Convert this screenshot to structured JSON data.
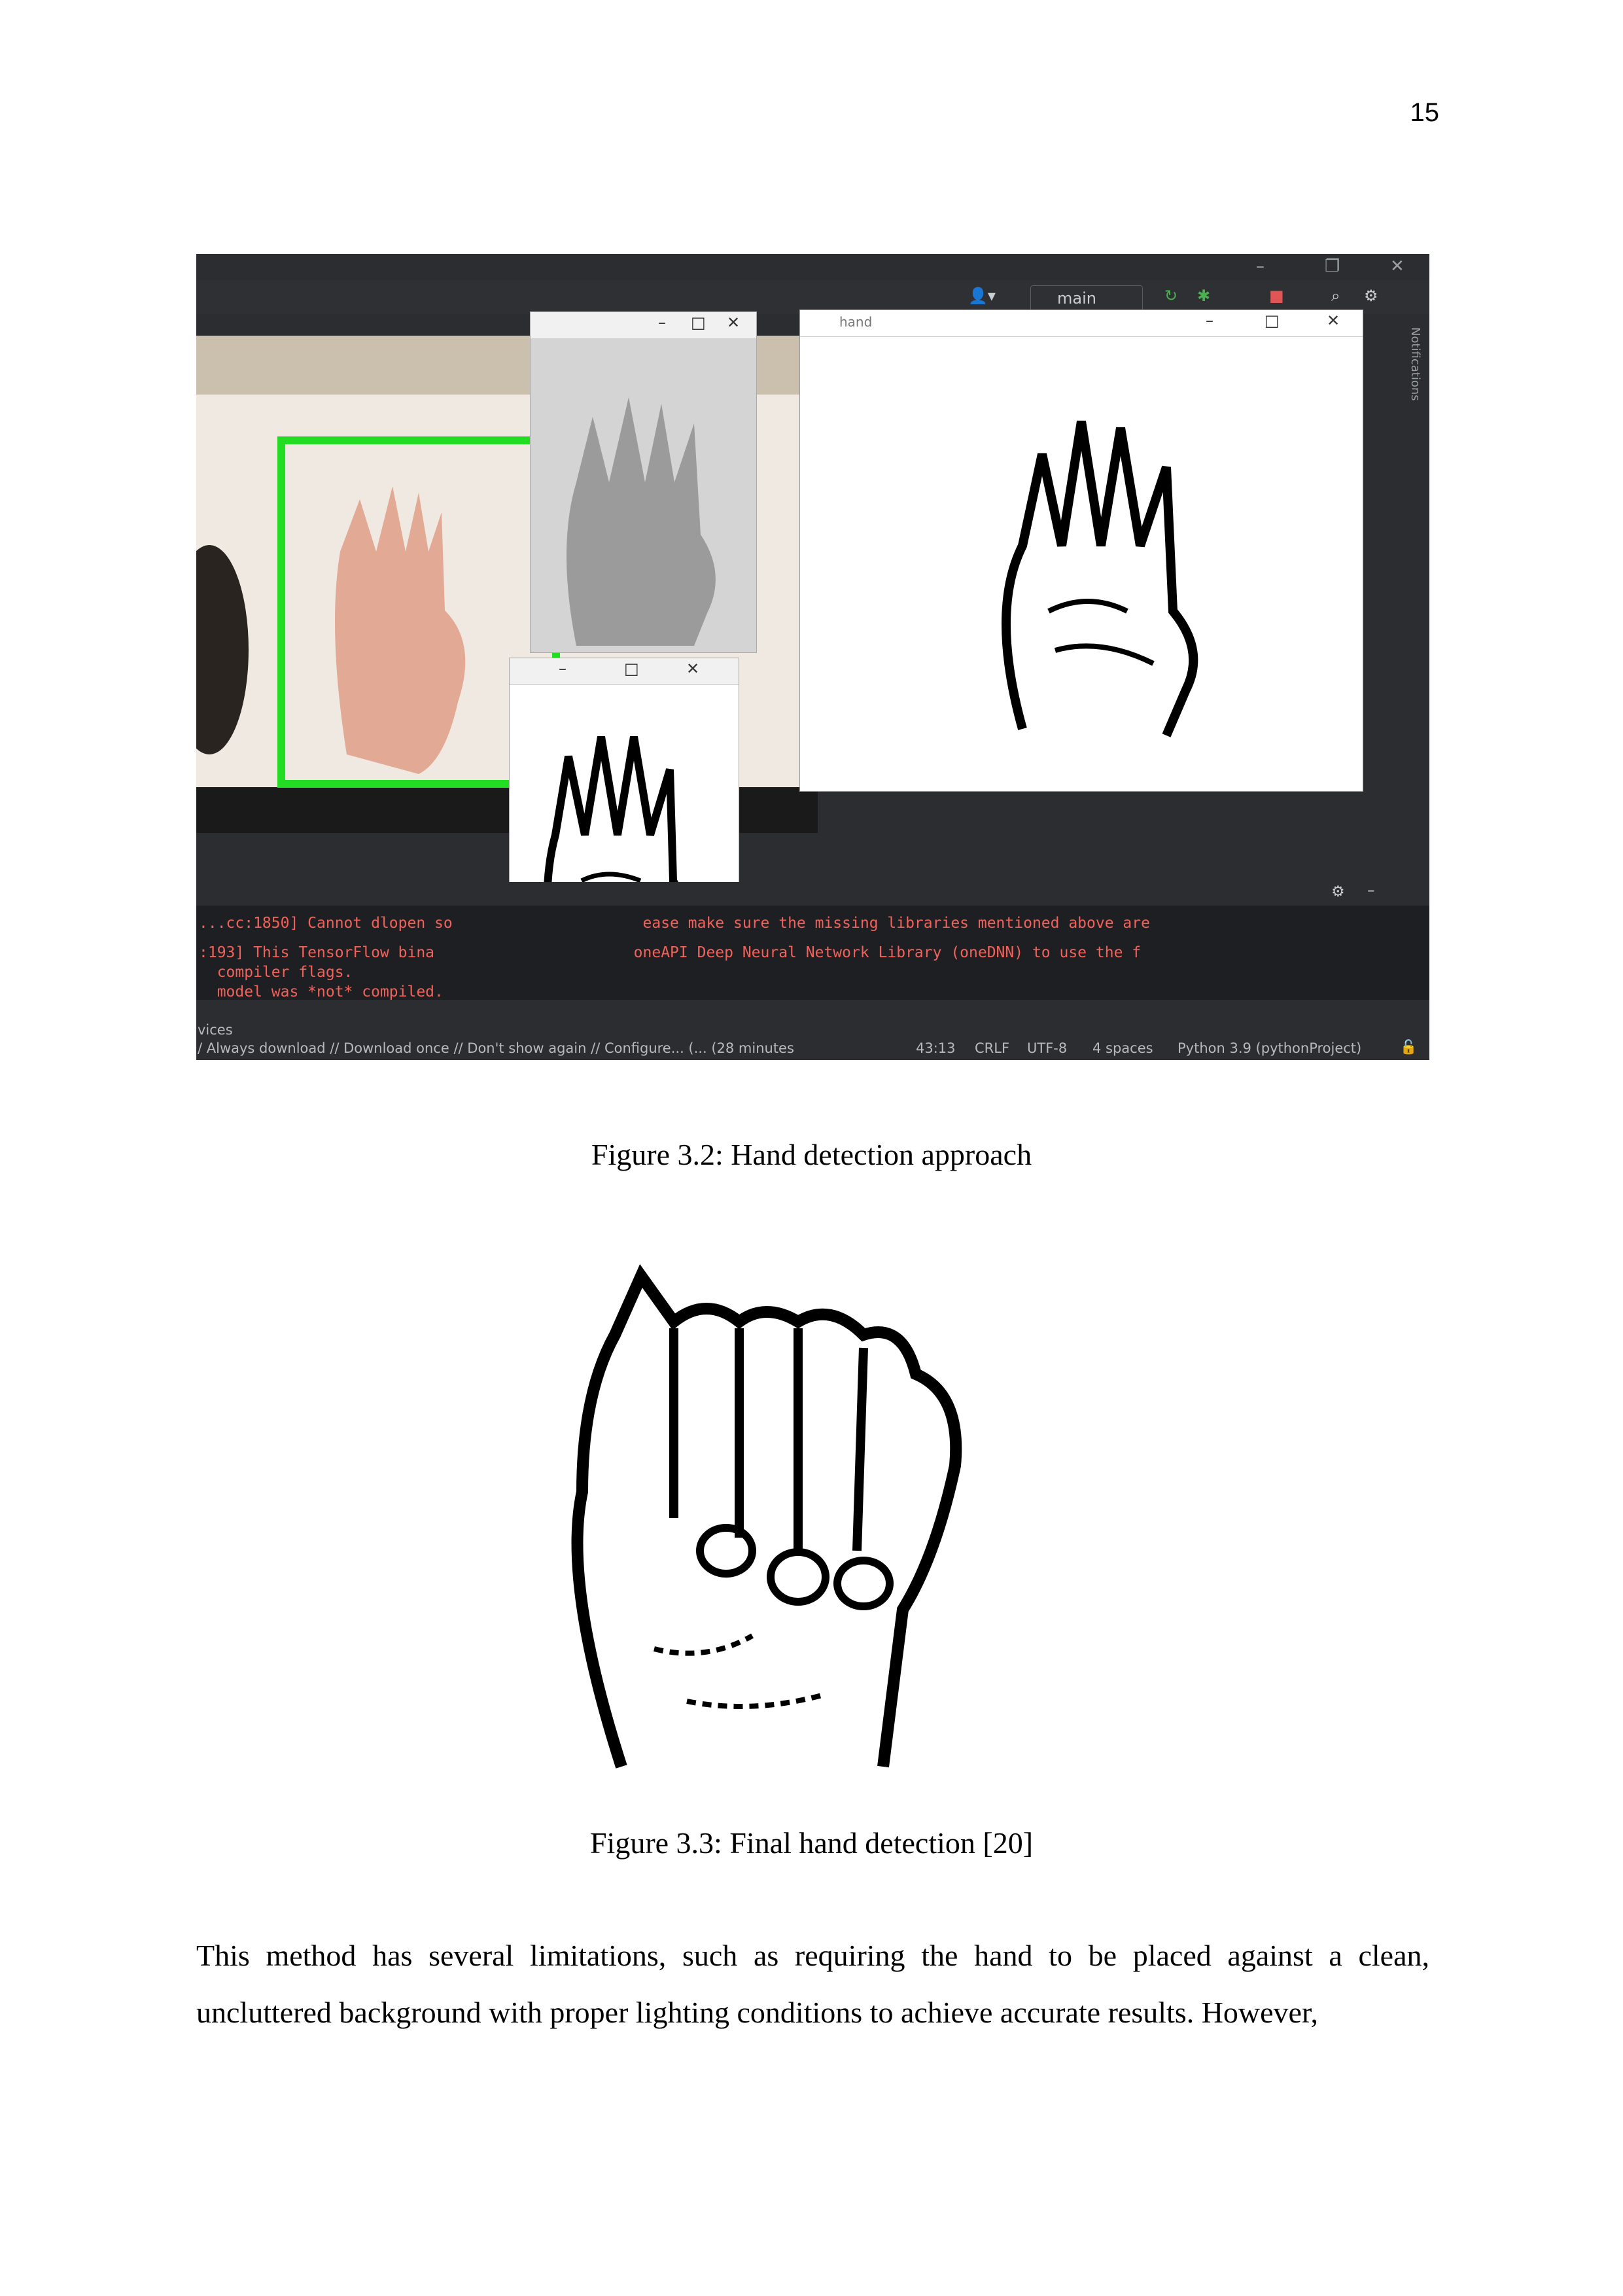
{
  "page_number": "15",
  "figure_1": {
    "caption": "Figure 3.2: Hand detection approach",
    "ide": {
      "branch": "main",
      "side_panel": "Notifications",
      "hand_window_title": "hand",
      "console_lines": [
        "...cc:1850] Cannot dlopen so                     ease make sure the missing libraries mentioned above are",
        ":193] This TensorFlow bina                      oneAPI Deep Neural Network Library (oneDNN) to use the f",
        "  compiler flags.",
        "  model was *not* compiled."
      ],
      "status_left_1": "vices",
      "status_left_2": "/ Always download // Download once // Don't show again // Configure... (... (28 minutes",
      "status_position": "43:13",
      "status_line_ending": "CRLF",
      "status_encoding": "UTF-8",
      "status_indent": "4 spaces",
      "status_interpreter": "Python 3.9 (pythonProject)"
    }
  },
  "figure_2": {
    "caption": "Figure 3.3: Final hand detection [20]"
  },
  "paragraph": "This method has several limitations, such as requiring the hand to be placed against a clean, uncluttered background with proper lighting conditions to achieve accurate results. However,",
  "colors": {
    "ide_bg": "#2b2d30",
    "detection_box": "#22dd22",
    "console_error": "#f2625a"
  }
}
